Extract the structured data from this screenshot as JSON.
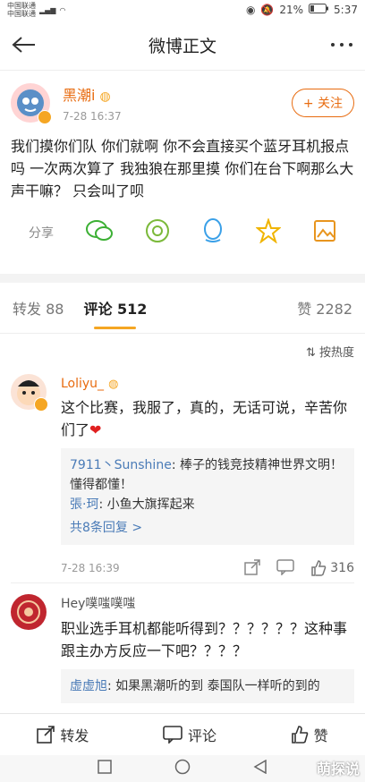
{
  "status": {
    "carrier1": "中国联通",
    "carrier2": "中国联通",
    "battery": "21%",
    "time": "5:37"
  },
  "nav": {
    "title": "微博正文"
  },
  "post": {
    "author": "黑潮i",
    "time": "7-28 16:37",
    "follow_label": "+ 关注",
    "text": "我们摸你们队 你们就啊 你不会直接买个蓝牙耳机报点吗 一次两次算了 我独狼在那里摸 你们在台下啊那么大声干嘛？ 只会叫了呗",
    "share_label": "分享",
    "share_icons": [
      "wechat-icon",
      "moments-icon",
      "qq-icon",
      "qzone-icon",
      "save-image-icon"
    ]
  },
  "tabs": {
    "repost": "转发 88",
    "comment": "评论 512",
    "like": "赞 2282"
  },
  "sort_label": "按热度",
  "comments": [
    {
      "name": "Loliyu_",
      "text": "这个比赛，我服了，真的，无话可说，辛苦你们了",
      "replies": [
        {
          "name": "7911丶Sunshine",
          "text": ": 棒子的钱竞技精神世界文明！懂得都懂！"
        },
        {
          "name": "張·珂",
          "text": ": 小鱼大旗挥起来"
        }
      ],
      "more": "共8条回复 >",
      "time": "7-28 16:39",
      "likes": "316"
    },
    {
      "name": "Hey噗嗤噗嗤",
      "text": "职业选手耳机都能听得到？？？？？？这种事跟主办方反应一下吧？？？？",
      "replies": [
        {
          "name": "虚虚旭",
          "text": ": 如果黑潮听的到 泰国队一样听的到的"
        }
      ]
    }
  ],
  "bottom": {
    "repost": "转发",
    "comment": "评论",
    "like": "赞"
  },
  "watermark": "萌探说"
}
